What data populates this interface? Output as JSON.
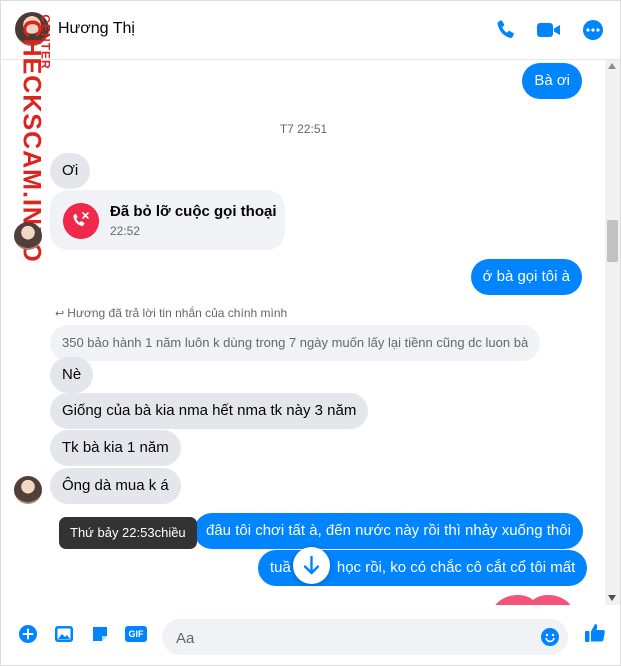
{
  "header": {
    "contact_name": "Hương Thị",
    "icons": [
      "phone-icon",
      "video-camera-icon",
      "more-options-icon"
    ]
  },
  "watermark": {
    "main": "CHECKSCAM.INFO",
    "sub": "CENTER"
  },
  "colors": {
    "accent": "#0084ff",
    "incoming_bubble": "#e4e6eb",
    "missed_call": "#f02849",
    "watermark": "#e0221c"
  },
  "messages": {
    "m1": "Bà ơi",
    "timestamp": "T7 22:51",
    "m2": "Ơi",
    "missed_call_title": "Đã bỏ lỡ cuộc gọi thoại",
    "missed_call_time": "22:52",
    "m3": "ớ bà gọi tôi à",
    "reply_note": "Hương đã trả lời tin nhắn của chính mình",
    "m4": "350 bảo hành 1 năm luôn k dùng trong 7 ngày muốn lấy lại tiềnn cũng dc luon bà",
    "m5": "Nè",
    "m6": "Giống của bà kia nma hết nma tk này 3 năm",
    "m7": "Tk bà kia 1 năm",
    "m8": "Ông dà mua k á",
    "m9": "đâu tôi chơi tất à, đến nước này rồi thì nhảy xuống thôi",
    "m10_start": "tuầ",
    "m10_end": "học rồi, ko có chắc cô cắt cổ tôi mất",
    "tooltip": "Thứ bảy 22:53chiều"
  },
  "composer": {
    "placeholder": "Aa",
    "icons": [
      "add-circle-icon",
      "image-icon",
      "sticker-icon",
      "gif-icon",
      "emoji-icon",
      "like-icon"
    ],
    "gif_label": "GIF"
  }
}
